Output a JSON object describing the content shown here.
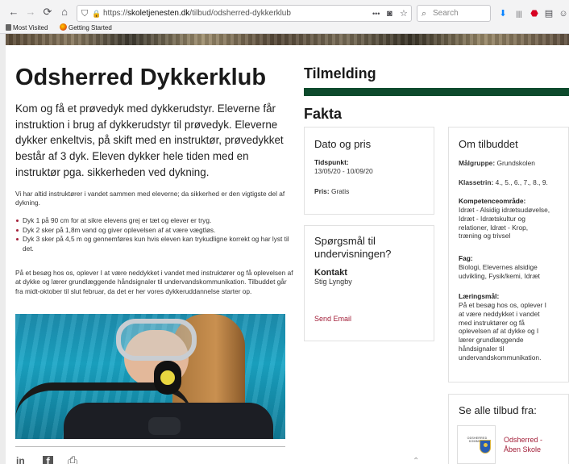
{
  "browser": {
    "url_scheme": "https://",
    "url_host": "skoletjenesten.dk",
    "url_path": "/tilbud/odsherred-dykkerklub",
    "url_more": "•••",
    "search_placeholder": "Search",
    "bookmarks": [
      {
        "label": "Most Visited"
      },
      {
        "label": "Getting Started"
      }
    ]
  },
  "article": {
    "title": "Odsherred Dykkerklub",
    "lead": "Kom og få et prøvedyk med dykkerudstyr. Eleverne får instruktion i brug af dykkerudstyr til prøvedyk. Eleverne dykker enkeltvis, på skift med en instruktør, prøvedykket består af 3 dyk. Eleven dykker hele tiden med en instruktør pga. sikkerheden ved dykning.",
    "para1": "Vi har altid instruktører i vandet sammen med eleverne; da sikkerhed er den vigtigste del af dykning.",
    "bullets": [
      "Dyk 1 på 90 cm for at sikre elevens grej er tæt og elever er tryg.",
      "Dyk 2 sker på 1,8m vand og giver oplevelsen af at være vægtløs.",
      "Dyk 3 sker på 4,5 m og gennemføres kun hvis eleven kan trykudligne korrekt og har lyst til det."
    ],
    "para2": "På et besøg hos os, oplever I at være neddykket i vandet med instruktører og få oplevelsen af at dykke og lærer grundlæggende håndsignaler til undervandskommunikation. Tilbuddet går fra midt-oktober til slut februar, da det er her vores dykkeruddannelse starter op."
  },
  "sidebar": {
    "tilmelding": "Tilmelding",
    "fakta": "Fakta",
    "dato": {
      "title": "Dato og pris",
      "tidspunkt_label": "Tidspunkt:",
      "tidspunkt_value": "13/05/20 - 10/09/20",
      "pris_label": "Pris:",
      "pris_value": "Gratis"
    },
    "questions": {
      "title_line1": "Spørgsmål til",
      "title_line2": "undervisningen?",
      "kontakt_label": "Kontakt",
      "kontakt_name": "Stig Lyngby",
      "send_email": "Send Email"
    },
    "about": {
      "title": "Om tilbuddet",
      "malgruppe_label": "Målgruppe:",
      "malgruppe_value": "Grundskolen",
      "klassetrin_label": "Klassetrin:",
      "klassetrin_value": "4., 5., 6., 7., 8., 9.",
      "kompetence_label": "Kompetenceområde:",
      "kompetence_lines": [
        "Idræt - Alsidig idrætsudøvelse,",
        "Idræt - Idrætskultur og",
        "relationer, Idræt - Krop,",
        "træning og trivsel"
      ],
      "fag_label": "Fag:",
      "fag_lines": [
        "Biologi, Elevernes alsidige",
        "udvikling, Fysik/kemi, Idræt"
      ],
      "laering_label": "Læringsmål:",
      "laering_lines": [
        "På et besøg hos os, oplever I",
        "at være neddykket i vandet",
        "med instruktører og få",
        "oplevelsen af at dykke og I",
        "lærer grundlæggende",
        "håndsignaler til",
        "undervandskommunikation."
      ]
    },
    "offers": {
      "title": "Se alle tilbud fra:",
      "logo_text": "ODSHERRED KOMMUNE",
      "link_line1": "Odsherred -",
      "link_line2": "Åben Skole"
    }
  },
  "icons": {
    "back": "←",
    "forward": "→",
    "reload": "⟳",
    "home": "⌂",
    "shield": "⛉",
    "lock": "🔒",
    "pocket": "◙",
    "star": "☆",
    "search": "⌕",
    "download": "⬇",
    "library": "|||",
    "adblock": "⬣",
    "sidebar": "▤",
    "account": "☺",
    "linkedin": "in",
    "facebook": "f",
    "print": "⎙"
  },
  "colors": {
    "accent_green": "#0d4a2c",
    "link_red": "#a3203a"
  }
}
